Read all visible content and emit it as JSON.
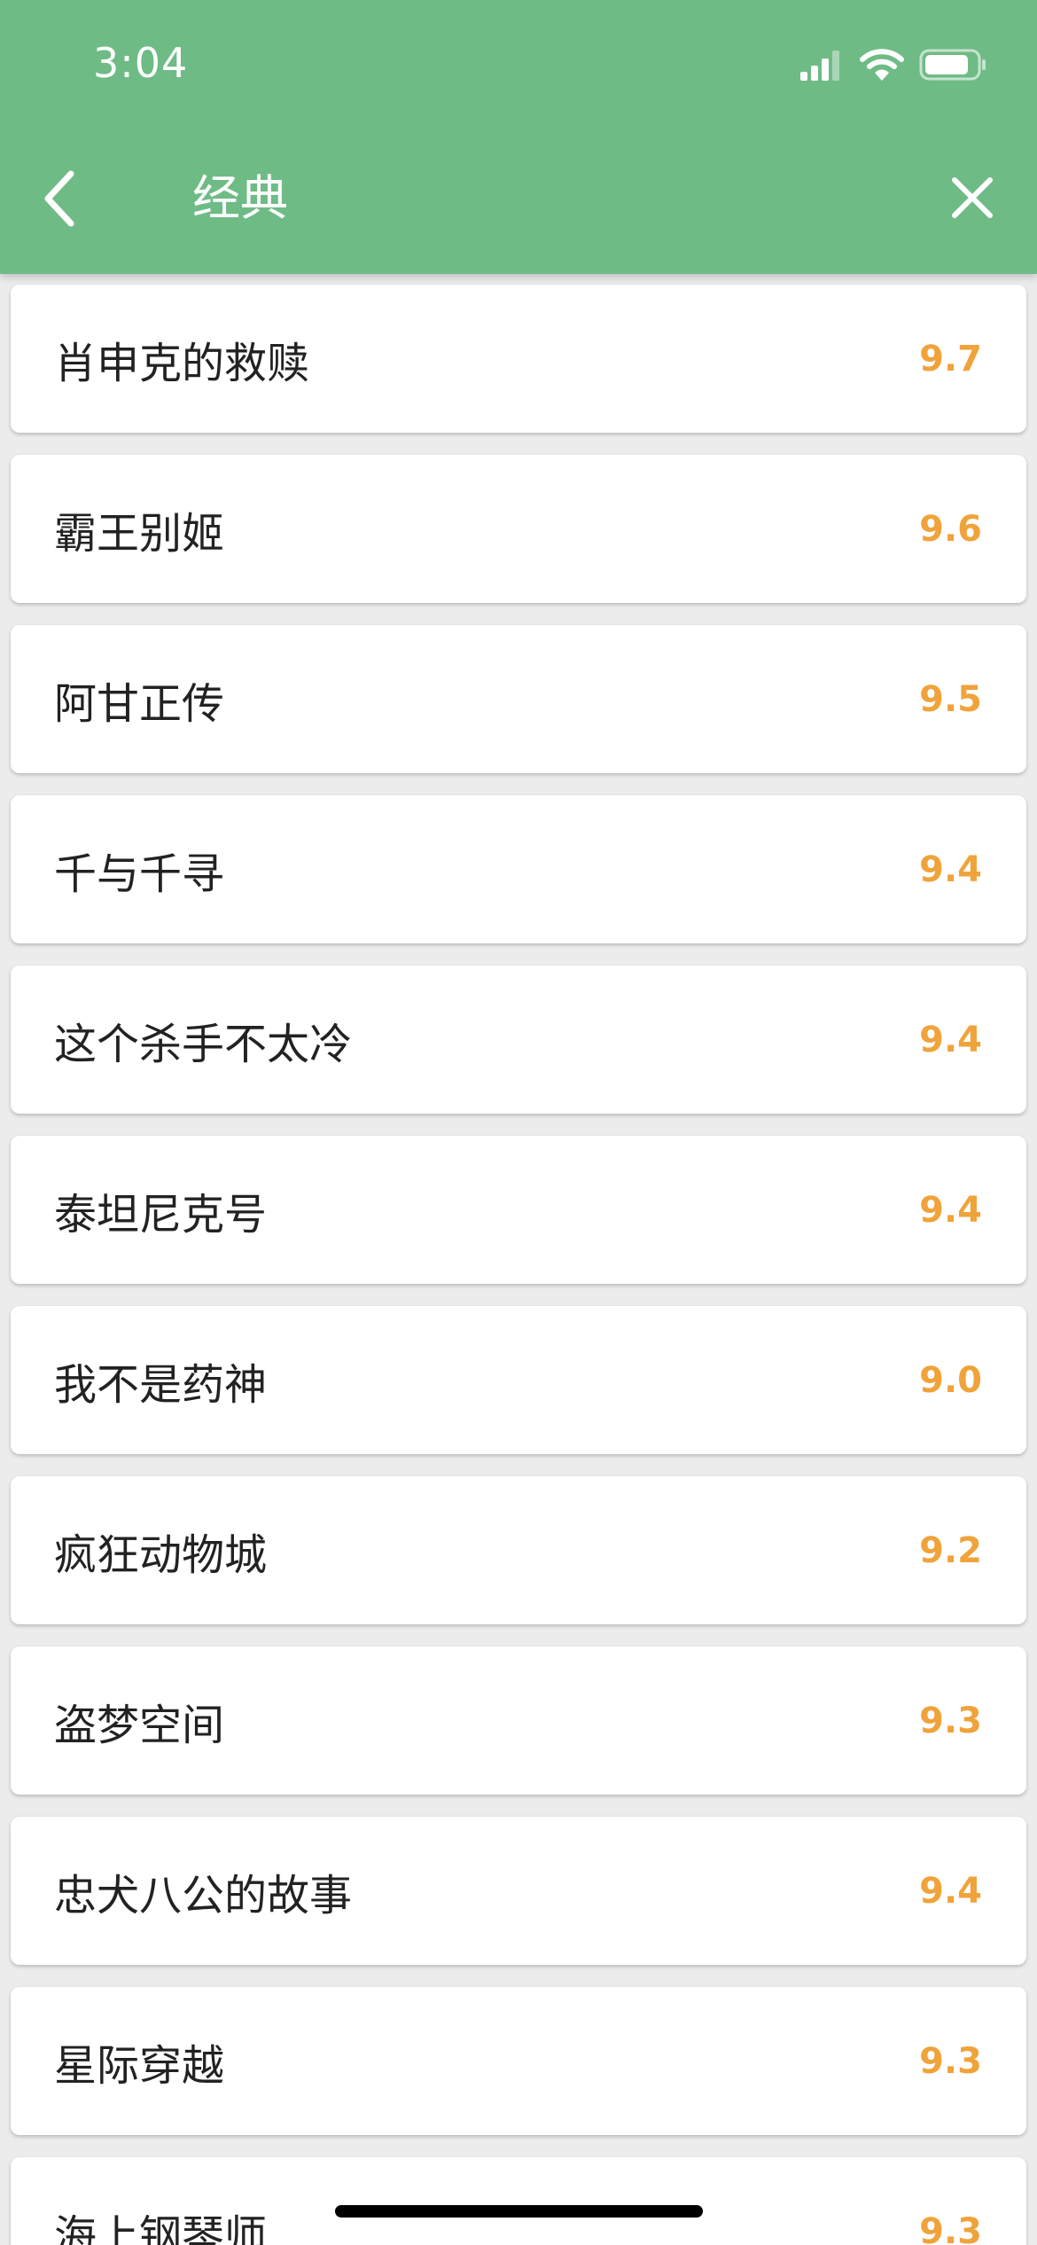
{
  "status_bar": {
    "time": "3:04",
    "signal_icon": "signal-bars-icon",
    "wifi_icon": "wifi-icon",
    "battery_icon": "battery-icon"
  },
  "nav": {
    "title": "经典",
    "back_icon": "chevron-left-icon",
    "close_icon": "close-icon"
  },
  "colors": {
    "header_bg": "#6fbb86",
    "score": "#f0a33a",
    "title_text": "#222222",
    "page_bg": "#ececec"
  },
  "movies": [
    {
      "title": "肖申克的救赎",
      "score": "9.7"
    },
    {
      "title": "霸王别姬",
      "score": "9.6"
    },
    {
      "title": "阿甘正传",
      "score": "9.5"
    },
    {
      "title": "千与千寻",
      "score": "9.4"
    },
    {
      "title": "这个杀手不太冷",
      "score": "9.4"
    },
    {
      "title": "泰坦尼克号",
      "score": "9.4"
    },
    {
      "title": "我不是药神",
      "score": "9.0"
    },
    {
      "title": "疯狂动物城",
      "score": "9.2"
    },
    {
      "title": "盗梦空间",
      "score": "9.3"
    },
    {
      "title": "忠犬八公的故事",
      "score": "9.4"
    },
    {
      "title": "星际穿越",
      "score": "9.3"
    },
    {
      "title": "海上钢琴师",
      "score": "9.3"
    }
  ]
}
